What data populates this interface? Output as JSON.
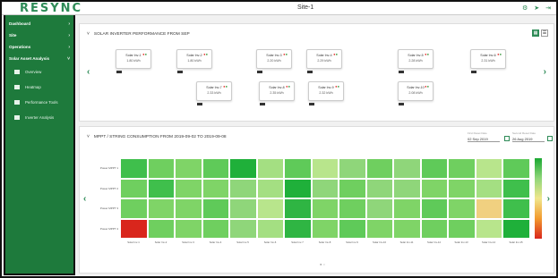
{
  "app": {
    "logo": "RESYNC",
    "site_title": "Site-1"
  },
  "top_icons": [
    "gear-icon",
    "send-icon",
    "logout-icon"
  ],
  "sidebar": {
    "items": [
      {
        "label": "Dashboard",
        "has_chevron": true
      },
      {
        "label": "Site",
        "has_chevron": true
      },
      {
        "label": "Operations",
        "has_chevron": true
      },
      {
        "label": "Solar Asset Analysis",
        "has_chevron": true,
        "expanded": true
      }
    ],
    "sub_items": [
      {
        "label": "Overview",
        "icon": "grid-icon"
      },
      {
        "label": "Heatmap",
        "icon": "heatmap-icon"
      },
      {
        "label": "Performance Tools",
        "icon": "chart-icon"
      },
      {
        "label": "Inverter Analysis",
        "icon": "inverter-icon"
      }
    ]
  },
  "performance_card": {
    "title": "SOLAR INVERTER PERFORMANCE FROM SEP",
    "inverters": [
      {
        "name": "Solar Inv-1",
        "value": "1.80 kWh"
      },
      {
        "name": "Solar Inv-2",
        "value": "1.80 kWh"
      },
      {
        "name": "Solar Inv-3",
        "value": "2.20 kWh"
      },
      {
        "name": "Solar Inv-4",
        "value": "2.29 kWh"
      },
      {
        "name": "Solar Inv-5",
        "value": "2.28 kWh"
      },
      {
        "name": "Solar Inv-6",
        "value": "2.31 kWh"
      },
      {
        "name": "Solar Inv-7",
        "value": "2.33 kWh"
      },
      {
        "name": "Solar Inv-8",
        "value": "2.35 kWh"
      },
      {
        "name": "Solar Inv-9",
        "value": "2.32 kWh"
      },
      {
        "name": "Solar Inv-10",
        "value": "2.08 kWh"
      }
    ]
  },
  "mppt_card": {
    "title": "MPPT / STRING CONSUMPTION FROM 2019-09-02 TO 2019-09-08",
    "first_date_label": "First Reset Date",
    "first_date": "02 Sep 2019",
    "second_date_label": "Second Reset Date",
    "second_date": "26 Aug 2019"
  },
  "chart_data": {
    "type": "heatmap",
    "rows": [
      "Power MPPT 1",
      "Power MPPT 2",
      "Power MPPT 3",
      "Power MPPT 4"
    ],
    "columns": [
      "Solar Inv-1",
      "Solar Inv-2",
      "Solar Inv-3",
      "Solar Inv-4",
      "Solar Inv-5",
      "Solar Inv-6",
      "Solar Inv-7",
      "Solar Inv-8",
      "Solar Inv-9",
      "Solar Inv-10",
      "Solar Inv-11",
      "Solar Inv-12",
      "Solar Inv-13",
      "Solar Inv-14",
      "Solar Inv-15"
    ],
    "colors": [
      [
        "#3fbf4c",
        "#6fcf5f",
        "#7fd467",
        "#5fca59",
        "#1fb03a",
        "#a4df82",
        "#5fca59",
        "#b8e58c",
        "#8fd67a",
        "#6fcf5f",
        "#8fd67a",
        "#5fca59",
        "#6fcf5f",
        "#b8e58c",
        "#5fca59"
      ],
      [
        "#6fcf5f",
        "#3fbf4c",
        "#7fd467",
        "#7fd467",
        "#8fd67a",
        "#a4df82",
        "#1fb03a",
        "#8fd67a",
        "#6fcf5f",
        "#8fd67a",
        "#8fd67a",
        "#7fd467",
        "#7fd467",
        "#a4df82",
        "#3fbf4c"
      ],
      [
        "#6fcf5f",
        "#7fd467",
        "#7fd467",
        "#5fca59",
        "#8fd67a",
        "#b8e58c",
        "#2fb543",
        "#7fd467",
        "#6fcf5f",
        "#8fd67a",
        "#7fd467",
        "#5fca59",
        "#7fd467",
        "#f0d080",
        "#3fbf4c"
      ],
      [
        "#d9261c",
        "#6fcf5f",
        "#7fd467",
        "#6fcf5f",
        "#8fd67a",
        "#a4df82",
        "#2fb543",
        "#7fd467",
        "#5fca59",
        "#7fd467",
        "#7fd467",
        "#6fcf5f",
        "#6fcf5f",
        "#b8e58c",
        "#1fb03a"
      ]
    ],
    "legend": [
      "#1aa832",
      "#d9261c"
    ]
  },
  "pager": {
    "dots": "● ○"
  }
}
